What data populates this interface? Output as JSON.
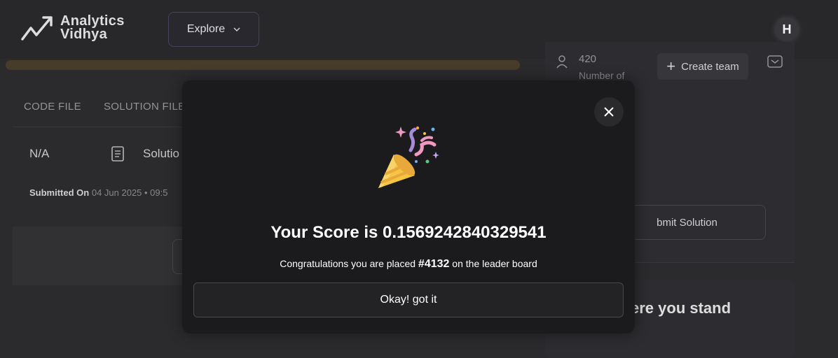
{
  "header": {
    "logo_line1": "Analytics",
    "logo_line2": "Vidhya",
    "explore_label": "Explore",
    "avatar_initial": "H"
  },
  "submission": {
    "tabs": [
      "CODE FILE",
      "SOLUTION FILE"
    ],
    "code_file_value": "N/A",
    "solution_label": "Solutio",
    "submitted_label": "Submitted On",
    "submitted_value": "04 Jun 2025 • 09:5"
  },
  "team": {
    "count": "420",
    "count_label": "Number of",
    "create_team_label": "Create team"
  },
  "submit_solution_label": "bmit Solution",
  "where_you_stand": "ere you stand",
  "modal": {
    "score_prefix": "Your Score is ",
    "score_value": "0.1569242840329541",
    "congrats_prefix": "Congratulations you are placed ",
    "rank": "#4132",
    "congrats_suffix": " on the leader board",
    "ok_label": "Okay! got it"
  },
  "colors": {
    "background": "#2d2c2f",
    "modal_bg": "#1b1a1c",
    "accent_progress": "#4a3f2a"
  }
}
